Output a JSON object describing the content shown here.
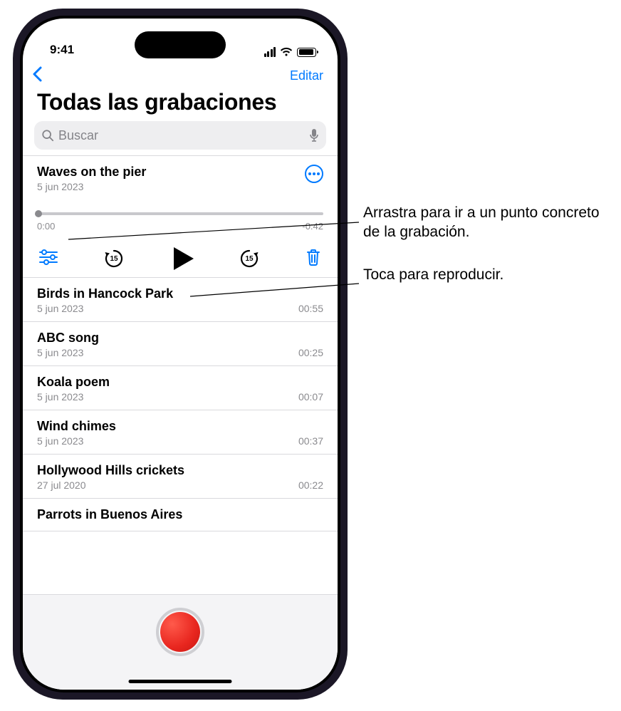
{
  "status": {
    "time": "9:41"
  },
  "nav": {
    "edit_label": "Editar"
  },
  "page_title": "Todas las grabaciones",
  "search": {
    "placeholder": "Buscar"
  },
  "expanded": {
    "title": "Waves on the pier",
    "date": "5 jun 2023",
    "elapsed": "0:00",
    "remaining": "-0:42",
    "skip_amount": "15"
  },
  "recordings": [
    {
      "title": "Birds in Hancock Park",
      "date": "5 jun 2023",
      "duration": "00:55"
    },
    {
      "title": "ABC song",
      "date": "5 jun 2023",
      "duration": "00:25"
    },
    {
      "title": "Koala poem",
      "date": "5 jun 2023",
      "duration": "00:07"
    },
    {
      "title": "Wind chimes",
      "date": "5 jun 2023",
      "duration": "00:37"
    },
    {
      "title": "Hollywood Hills crickets",
      "date": "27 jul 2020",
      "duration": "00:22"
    },
    {
      "title": "Parrots in Buenos Aires",
      "date": "",
      "duration": ""
    }
  ],
  "annotations": {
    "scrub": "Arrastra para ir a un punto concreto de la grabación.",
    "play": "Toca para reproducir."
  },
  "colors": {
    "accent": "#007aff",
    "record": "#e8261f"
  }
}
